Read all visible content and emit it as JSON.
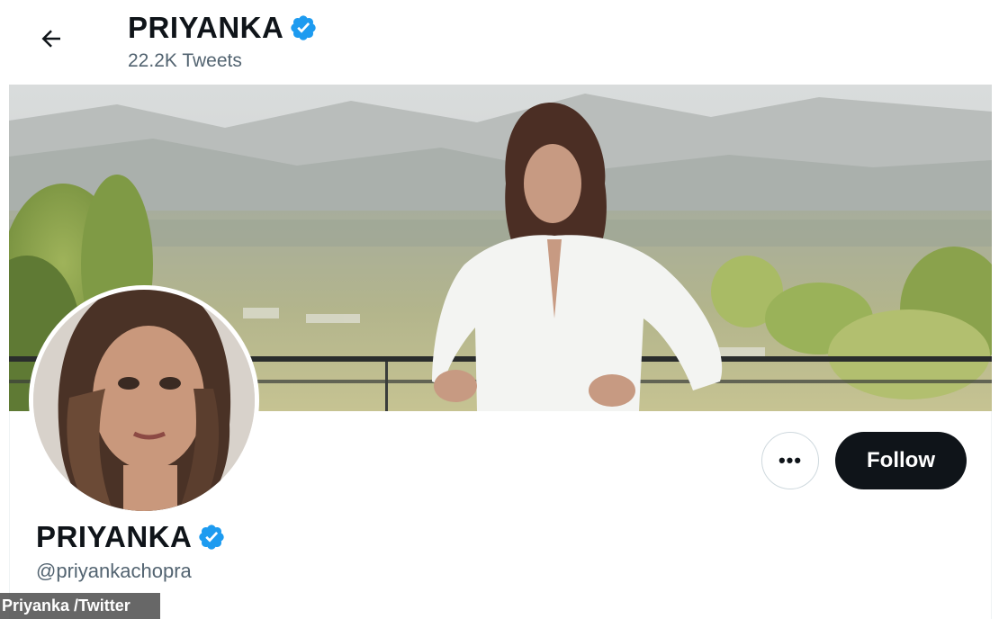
{
  "header": {
    "name": "PRIYANKA",
    "tweet_count": "22.2K Tweets",
    "back_icon": "arrow-left-icon"
  },
  "profile": {
    "name": "PRIYANKA",
    "handle": "@priyankachopra",
    "verified_icon": "verified-badge-icon",
    "bio_partial": ""
  },
  "actions": {
    "more_label": "•••",
    "follow_label": "Follow"
  },
  "credit": {
    "text": "Priyanka /Twitter"
  },
  "colors": {
    "verified_blue": "#1d9bf0",
    "follow_bg": "#0f1419",
    "secondary_text": "#536471"
  }
}
